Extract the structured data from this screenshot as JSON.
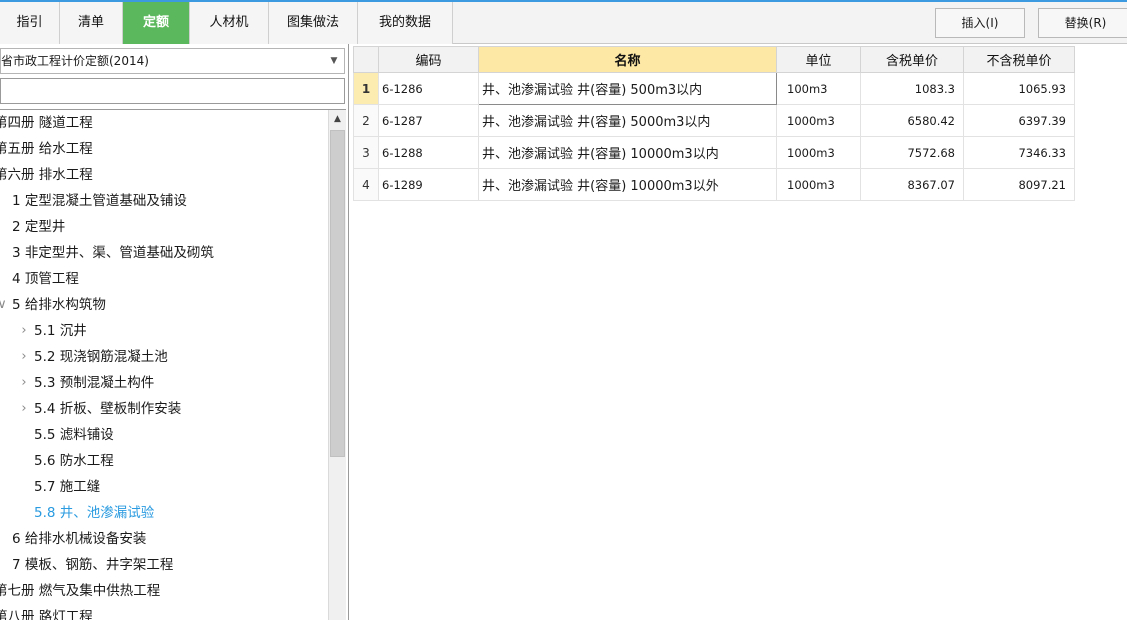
{
  "tabs": [
    {
      "label": "指引",
      "active": false
    },
    {
      "label": "清单",
      "active": false
    },
    {
      "label": "定额",
      "active": true
    },
    {
      "label": "人材机",
      "active": false
    },
    {
      "label": "图集做法",
      "active": false
    },
    {
      "label": "我的数据",
      "active": false
    }
  ],
  "toolbar": {
    "insert_label": "插入(I)",
    "replace_label": "替换(R)"
  },
  "left_panel": {
    "quota_library": "省市政工程计价定额(2014)",
    "search_value": "",
    "search_placeholder": ""
  },
  "tree": {
    "items": [
      {
        "label": "第四册 隧道工程",
        "indent": 0,
        "arrow": "",
        "selected": false
      },
      {
        "label": "第五册 给水工程",
        "indent": 0,
        "arrow": "",
        "selected": false
      },
      {
        "label": "第六册 排水工程",
        "indent": 0,
        "arrow": "",
        "selected": false
      },
      {
        "label": "1 定型混凝土管道基础及铺设",
        "indent": 1,
        "arrow": "",
        "selected": false
      },
      {
        "label": "2 定型井",
        "indent": 1,
        "arrow": "",
        "selected": false
      },
      {
        "label": "3 非定型井、渠、管道基础及砌筑",
        "indent": 1,
        "arrow": "",
        "selected": false
      },
      {
        "label": "4 顶管工程",
        "indent": 1,
        "arrow": "",
        "selected": false
      },
      {
        "label": "5 给排水构筑物",
        "indent": 1,
        "arrow": "expanded",
        "selected": false
      },
      {
        "label": "5.1 沉井",
        "indent": 2,
        "arrow": "collapsed",
        "selected": false
      },
      {
        "label": "5.2 现浇钢筋混凝土池",
        "indent": 2,
        "arrow": "collapsed",
        "selected": false
      },
      {
        "label": "5.3 预制混凝土构件",
        "indent": 2,
        "arrow": "collapsed",
        "selected": false
      },
      {
        "label": "5.4 折板、壁板制作安装",
        "indent": 2,
        "arrow": "collapsed",
        "selected": false
      },
      {
        "label": "5.5 滤料铺设",
        "indent": 2,
        "arrow": "",
        "selected": false
      },
      {
        "label": "5.6 防水工程",
        "indent": 2,
        "arrow": "",
        "selected": false
      },
      {
        "label": "5.7 施工缝",
        "indent": 2,
        "arrow": "",
        "selected": false
      },
      {
        "label": "5.8 井、池渗漏试验",
        "indent": 2,
        "arrow": "",
        "selected": true
      },
      {
        "label": "6 给排水机械设备安装",
        "indent": 1,
        "arrow": "",
        "selected": false
      },
      {
        "label": "7 模板、钢筋、井字架工程",
        "indent": 1,
        "arrow": "",
        "selected": false
      },
      {
        "label": "第七册 燃气及集中供热工程",
        "indent": 0,
        "arrow": "",
        "selected": false
      },
      {
        "label": "第八册 路灯工程",
        "indent": 0,
        "arrow": "",
        "selected": false
      }
    ]
  },
  "table": {
    "headers": [
      "编码",
      "名称",
      "单位",
      "含税单价",
      "不含税单价"
    ],
    "rows": [
      {
        "no": "1",
        "code": "6-1286",
        "name": "井、池渗漏试验 井(容量) 500m3以内",
        "unit": "100m3",
        "tax_price": "1083.3",
        "notax_price": "1065.93",
        "active": true
      },
      {
        "no": "2",
        "code": "6-1287",
        "name": "井、池渗漏试验 井(容量) 5000m3以内",
        "unit": "1000m3",
        "tax_price": "6580.42",
        "notax_price": "6397.39",
        "active": false
      },
      {
        "no": "3",
        "code": "6-1288",
        "name": "井、池渗漏试验 井(容量) 10000m3以内",
        "unit": "1000m3",
        "tax_price": "7572.68",
        "notax_price": "7346.33",
        "active": false
      },
      {
        "no": "4",
        "code": "6-1289",
        "name": "井、池渗漏试验 井(容量) 10000m3以外",
        "unit": "1000m3",
        "tax_price": "8367.07",
        "notax_price": "8097.21",
        "active": false
      }
    ]
  },
  "colors": {
    "active_tab": "#5cb85c",
    "selected_tree_item": "#2a9be0",
    "name_header": "#fde8a6"
  }
}
